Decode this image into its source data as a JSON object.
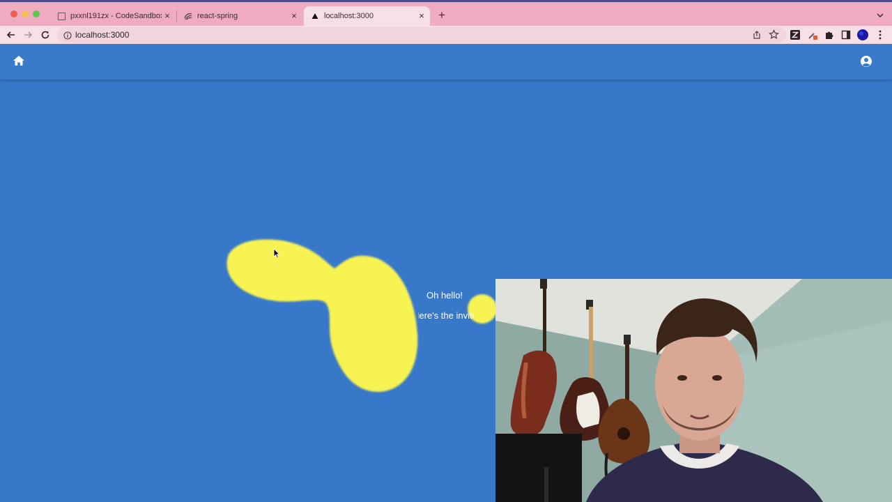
{
  "browser": {
    "tabs": [
      {
        "title": "pxxnl191zx - CodeSandbox",
        "favicon": "codesandbox-icon",
        "active": false
      },
      {
        "title": "react-spring",
        "favicon": "react-spring-icon",
        "active": false
      },
      {
        "title": "localhost:3000",
        "favicon": "triangle-icon",
        "active": true
      }
    ],
    "close_glyph": "×",
    "new_tab_glyph": "+",
    "url": "localhost:3000"
  },
  "app": {
    "appbar": {
      "left_icon": "home-icon",
      "right_icon": "account-circle-icon"
    },
    "messages": [
      "Oh hello!",
      "Here's the invite link"
    ]
  },
  "colors": {
    "tabbar": "#efacc0",
    "toolbar": "#f7dfe6",
    "page_background": "#3878c8",
    "appbar": "#3a7acb",
    "blob": "#f6f352"
  }
}
